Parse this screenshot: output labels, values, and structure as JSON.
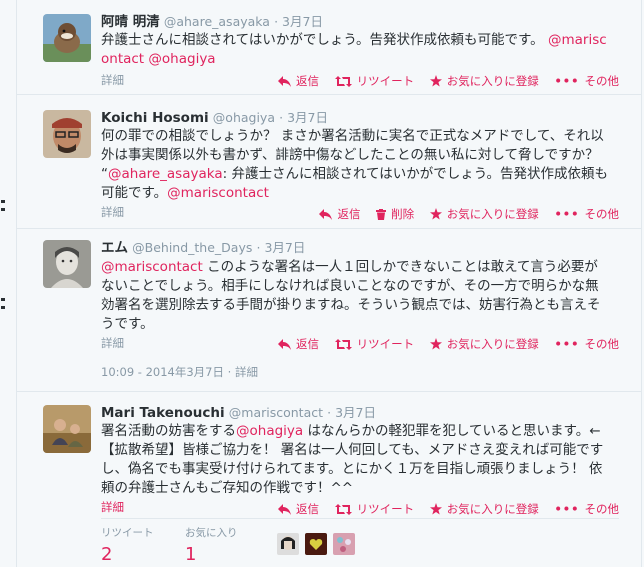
{
  "tweets": [
    {
      "fullname": "阿晴 明清",
      "username": "@ahare_asayaka",
      "time": "· 3月7日",
      "text_parts": [
        "弁護士さんに相談されてはいかがでしょう。告発状作成依頼も可能です。",
        "@mariscontact",
        "@ohagiya"
      ],
      "details": "詳細",
      "actions": {
        "reply": "返信",
        "retweet": "リツイート",
        "favorite": "お気に入りに登録",
        "more": "その他"
      }
    },
    {
      "fullname": "Koichi Hosomi",
      "username": "@ohagiya",
      "time": "· 3月7日",
      "text_parts": [
        "何の罪での相談でしょうか？ まさか署名活動に実名で正式なメアドでして、それ以外は事実関係以外も書かず、誹謗中傷などしたことの無い私に対して脅しですか？ “",
        "@ahare_asayaka",
        ": 弁護士さんに相談されてはいかがでしょう。告発状作成依頼も可能です。",
        "@mariscontact"
      ],
      "details": "詳細",
      "actions": {
        "reply": "返信",
        "delete": "削除",
        "favorite": "お気に入りに登録",
        "more": "その他"
      }
    },
    {
      "fullname": "エム",
      "username": "@Behind_the_Days",
      "time": "· 3月7日",
      "text_parts": [
        "@mariscontact",
        " このような署名は一人１回しかできないことは敢えて言う必要がないことでしょう。相手にしなければ良いことなのですが、その一方で明らかな無効署名を選別除去する手間が掛りますね。そういう観点では、妨害行為とも言えそうです。"
      ],
      "details": "詳細",
      "actions": {
        "reply": "返信",
        "retweet": "リツイート",
        "favorite": "お気に入りに登録",
        "more": "その他"
      },
      "timestamp": "10:09 - 2014年3月7日 · 詳細"
    },
    {
      "fullname": "Mari Takenouchi",
      "username": "@mariscontact",
      "time": "· 3月7日",
      "text_parts": [
        "署名活動の妨害をする",
        "@ohagiya",
        " はなんらかの軽犯罪を犯していると思います。←【拡散希望】皆様ご協力を！ 署名は一人何回しても、メアドさえ変えれば可能ですし、偽名でも事実受け付けられてます。とにかく１万を目指し頑張りましょう！ 依頼の弁護士さんもご存知の作戦です！^^"
      ],
      "details": "詳細",
      "actions": {
        "reply": "返信",
        "retweet": "リツイート",
        "favorite": "お気に入りに登録",
        "more": "その他"
      },
      "stats": {
        "retweet_label": "リツイート",
        "retweet_count": "2",
        "favorite_label": "お気に入り",
        "favorite_count": "1"
      }
    }
  ],
  "colors": {
    "accent": "#e0245e",
    "muted": "#8899a6",
    "text": "#292f33",
    "background": "#f5f8fa"
  }
}
